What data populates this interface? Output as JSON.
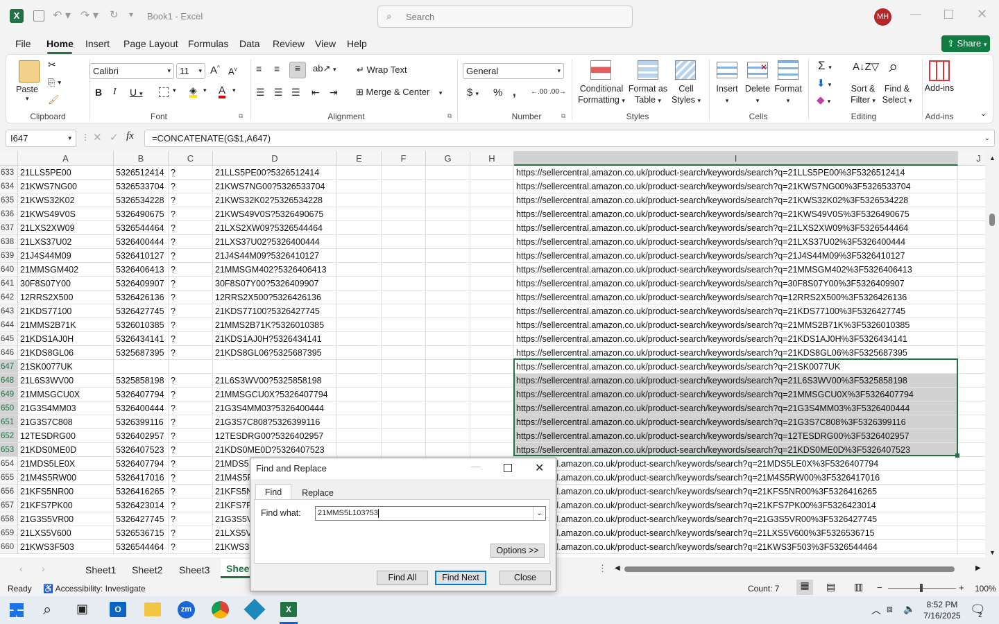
{
  "titlebar": {
    "title": "Book1  -  Excel",
    "search_placeholder": "Search",
    "avatar": "MH"
  },
  "menu": {
    "tabs": [
      "File",
      "Home",
      "Insert",
      "Page Layout",
      "Formulas",
      "Data",
      "Review",
      "View",
      "Help"
    ],
    "share": "Share"
  },
  "ribbon": {
    "clipboard": {
      "paste": "Paste",
      "label": "Clipboard"
    },
    "font": {
      "name": "Calibri",
      "size": "11",
      "label": "Font"
    },
    "alignment": {
      "wrap": "Wrap Text",
      "merge": "Merge & Center",
      "label": "Alignment"
    },
    "number": {
      "format": "General",
      "label": "Number"
    },
    "styles": {
      "conditional": "Conditional",
      "formatting": "Formatting",
      "format_as": "Format as",
      "table": "Table",
      "cell": "Cell",
      "styles": "Styles",
      "label": "Styles"
    },
    "cells": {
      "insert": "Insert",
      "delete": "Delete",
      "format": "Format",
      "label": "Cells"
    },
    "editing": {
      "sort1": "Sort &",
      "sort2": "Filter",
      "find1": "Find &",
      "find2": "Select",
      "label": "Editing"
    },
    "addins": {
      "btn": "Add-ins",
      "label": "Add-ins"
    }
  },
  "formula_bar": {
    "name_box": "I647",
    "formula": "=CONCATENATE(G$1,A647)"
  },
  "columns": [
    "A",
    "B",
    "C",
    "D",
    "E",
    "F",
    "G",
    "H",
    "I",
    "J"
  ],
  "rows": [
    {
      "n": "633",
      "a": "21LLS5PE00",
      "b": "5326512414",
      "c": "?",
      "d": "21LLS5PE00?5326512414",
      "i": "https://sellercentral.amazon.co.uk/product-search/keywords/search?q=21LLS5PE00%3F5326512414"
    },
    {
      "n": "634",
      "a": "21KWS7NG00",
      "b": "5326533704",
      "c": "?",
      "d": "21KWS7NG00?5326533704",
      "i": "https://sellercentral.amazon.co.uk/product-search/keywords/search?q=21KWS7NG00%3F5326533704"
    },
    {
      "n": "635",
      "a": "21KWS32K02",
      "b": "5326534228",
      "c": "?",
      "d": "21KWS32K02?5326534228",
      "i": "https://sellercentral.amazon.co.uk/product-search/keywords/search?q=21KWS32K02%3F5326534228"
    },
    {
      "n": "636",
      "a": "21KWS49V0S",
      "b": "5326490675",
      "c": "?",
      "d": "21KWS49V0S?5326490675",
      "i": "https://sellercentral.amazon.co.uk/product-search/keywords/search?q=21KWS49V0S%3F5326490675"
    },
    {
      "n": "637",
      "a": "21LXS2XW09",
      "b": "5326544464",
      "c": "?",
      "d": "21LXS2XW09?5326544464",
      "i": "https://sellercentral.amazon.co.uk/product-search/keywords/search?q=21LXS2XW09%3F5326544464"
    },
    {
      "n": "638",
      "a": "21LXS37U02",
      "b": "5326400444",
      "c": "?",
      "d": "21LXS37U02?5326400444",
      "i": "https://sellercentral.amazon.co.uk/product-search/keywords/search?q=21LXS37U02%3F5326400444"
    },
    {
      "n": "639",
      "a": "21J4S44M09",
      "b": "5326410127",
      "c": "?",
      "d": "21J4S44M09?5326410127",
      "i": "https://sellercentral.amazon.co.uk/product-search/keywords/search?q=21J4S44M09%3F5326410127"
    },
    {
      "n": "640",
      "a": "21MMSGM402",
      "b": "5326406413",
      "c": "?",
      "d": "21MMSGM402?5326406413",
      "i": "https://sellercentral.amazon.co.uk/product-search/keywords/search?q=21MMSGM402%3F5326406413"
    },
    {
      "n": "641",
      "a": "30F8S07Y00",
      "b": "5326409907",
      "c": "?",
      "d": "30F8S07Y00?5326409907",
      "i": "https://sellercentral.amazon.co.uk/product-search/keywords/search?q=30F8S07Y00%3F5326409907"
    },
    {
      "n": "642",
      "a": "12RRS2X500",
      "b": "5326426136",
      "c": "?",
      "d": "12RRS2X500?5326426136",
      "i": "https://sellercentral.amazon.co.uk/product-search/keywords/search?q=12RRS2X500%3F5326426136"
    },
    {
      "n": "643",
      "a": "21KDS77100",
      "b": "5326427745",
      "c": "?",
      "d": "21KDS77100?5326427745",
      "i": "https://sellercentral.amazon.co.uk/product-search/keywords/search?q=21KDS77100%3F5326427745"
    },
    {
      "n": "644",
      "a": "21MMS2B71K",
      "b": "5326010385",
      "c": "?",
      "d": "21MMS2B71K?5326010385",
      "i": "https://sellercentral.amazon.co.uk/product-search/keywords/search?q=21MMS2B71K%3F5326010385"
    },
    {
      "n": "645",
      "a": "21KDS1AJ0H",
      "b": "5326434141",
      "c": "?",
      "d": "21KDS1AJ0H?5326434141",
      "i": "https://sellercentral.amazon.co.uk/product-search/keywords/search?q=21KDS1AJ0H%3F5326434141"
    },
    {
      "n": "646",
      "a": "21KDS8GL06",
      "b": "5325687395",
      "c": "?",
      "d": "21KDS8GL06?5325687395",
      "i": "https://sellercentral.amazon.co.uk/product-search/keywords/search?q=21KDS8GL06%3F5325687395"
    },
    {
      "n": "647",
      "a": "21SK0077UK",
      "b": "",
      "c": "",
      "d": "",
      "i": "https://sellercentral.amazon.co.uk/product-search/keywords/search?q=21SK0077UK"
    },
    {
      "n": "648",
      "a": "21L6S3WV00",
      "b": "5325858198",
      "c": "?",
      "d": "21L6S3WV00?5325858198",
      "i": "https://sellercentral.amazon.co.uk/product-search/keywords/search?q=21L6S3WV00%3F5325858198"
    },
    {
      "n": "649",
      "a": "21MMSGCU0X",
      "b": "5326407794",
      "c": "?",
      "d": "21MMSGCU0X?5326407794",
      "i": "https://sellercentral.amazon.co.uk/product-search/keywords/search?q=21MMSGCU0X%3F5326407794"
    },
    {
      "n": "650",
      "a": "21G3S4MM03",
      "b": "5326400444",
      "c": "?",
      "d": "21G3S4MM03?5326400444",
      "i": "https://sellercentral.amazon.co.uk/product-search/keywords/search?q=21G3S4MM03%3F5326400444"
    },
    {
      "n": "651",
      "a": "21G3S7C808",
      "b": "5326399116",
      "c": "?",
      "d": "21G3S7C808?5326399116",
      "i": "https://sellercentral.amazon.co.uk/product-search/keywords/search?q=21G3S7C808%3F5326399116"
    },
    {
      "n": "652",
      "a": "12TESDRG00",
      "b": "5326402957",
      "c": "?",
      "d": "12TESDRG00?5326402957",
      "i": "https://sellercentral.amazon.co.uk/product-search/keywords/search?q=12TESDRG00%3F5326402957"
    },
    {
      "n": "653",
      "a": "21KDS0ME0D",
      "b": "5326407523",
      "c": "?",
      "d": "21KDS0ME0D?5326407523",
      "i": "https://sellercentral.amazon.co.uk/product-search/keywords/search?q=21KDS0ME0D%3F5326407523"
    },
    {
      "n": "654",
      "a": "21MDS5LE0X",
      "b": "5326407794",
      "c": "?",
      "d": "21MDS5",
      "i": "ellercentral.amazon.co.uk/product-search/keywords/search?q=21MDS5LE0X%3F5326407794"
    },
    {
      "n": "655",
      "a": "21M4S5RW00",
      "b": "5326417016",
      "c": "?",
      "d": "21M4S5F",
      "i": "ellercentral.amazon.co.uk/product-search/keywords/search?q=21M4S5RW00%3F5326417016"
    },
    {
      "n": "656",
      "a": "21KFS5NR00",
      "b": "5326416265",
      "c": "?",
      "d": "21KFS5N",
      "i": "ellercentral.amazon.co.uk/product-search/keywords/search?q=21KFS5NR00%3F5326416265"
    },
    {
      "n": "657",
      "a": "21KFS7PK00",
      "b": "5326423014",
      "c": "?",
      "d": "21KFS7P",
      "i": "ellercentral.amazon.co.uk/product-search/keywords/search?q=21KFS7PK00%3F5326423014"
    },
    {
      "n": "658",
      "a": "21G3S5VR00",
      "b": "5326427745",
      "c": "?",
      "d": "21G3S5V",
      "i": "ellercentral.amazon.co.uk/product-search/keywords/search?q=21G3S5VR00%3F5326427745"
    },
    {
      "n": "659",
      "a": "21LXS5V600",
      "b": "5326536715",
      "c": "?",
      "d": "21LXS5V",
      "i": "ellercentral.amazon.co.uk/product-search/keywords/search?q=21LXS5V600%3F5326536715"
    },
    {
      "n": "660",
      "a": "21KWS3F503",
      "b": "5326544464",
      "c": "?",
      "d": "21KWS3",
      "i": "ellercentral.amazon.co.uk/product-search/keywords/search?q=21KWS3F503%3F5326544464"
    }
  ],
  "sheets": [
    "Sheet1",
    "Sheet2",
    "Sheet3",
    "Sheet"
  ],
  "status": {
    "ready": "Ready",
    "accessibility": "Accessibility: Investigate",
    "count": "Count: 7",
    "zoom": "100%"
  },
  "dialog": {
    "title": "Find and Replace",
    "tab_find": "Find",
    "tab_replace": "Replace",
    "find_label": "Find what:",
    "find_value": "21MMS5L103?53",
    "options": "Options >>",
    "find_all": "Find All",
    "find_next": "Find Next",
    "close": "Close"
  },
  "taskbar": {
    "time": "8:52 PM",
    "date": "7/16/2025",
    "notif": "2"
  },
  "colors": {
    "excel_green": "#217346",
    "share_green": "#107c41",
    "avatar_red": "#b4262a",
    "selection_gray": "#d2d2d2"
  }
}
